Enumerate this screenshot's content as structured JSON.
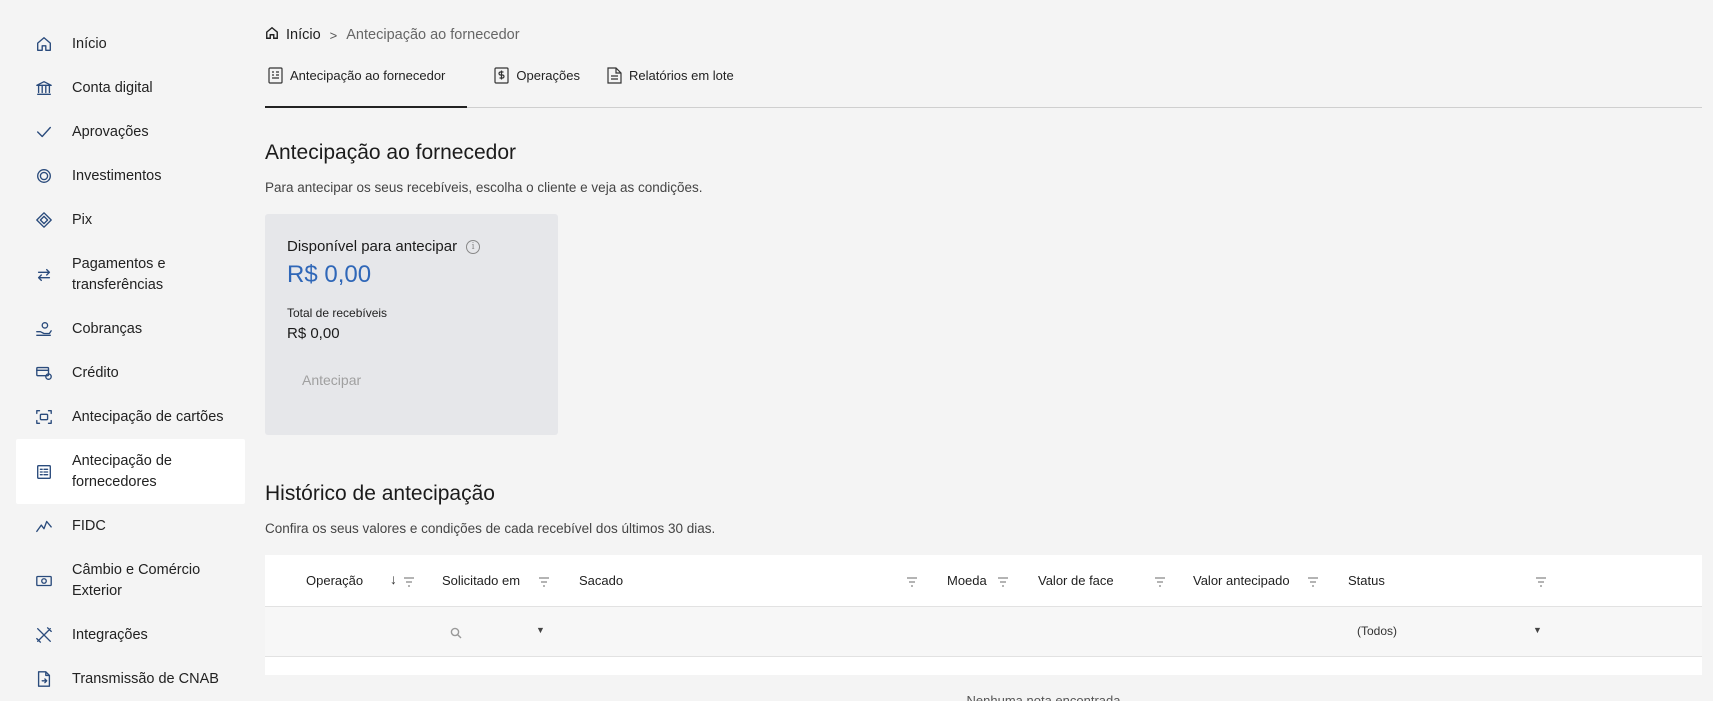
{
  "sidebar": {
    "items": [
      {
        "label": "Início",
        "icon": "home-icon"
      },
      {
        "label": "Conta digital",
        "icon": "bank-icon"
      },
      {
        "label": "Aprovações",
        "icon": "check-icon"
      },
      {
        "label": "Investimentos",
        "icon": "investment-icon"
      },
      {
        "label": "Pix",
        "icon": "pix-icon"
      },
      {
        "label": "Pagamentos e transferências",
        "icon": "transfer-icon"
      },
      {
        "label": "Cobranças",
        "icon": "billing-icon"
      },
      {
        "label": "Crédito",
        "icon": "credit-icon"
      },
      {
        "label": "Antecipação de cartões",
        "icon": "card-anticipation-icon"
      },
      {
        "label": "Antecipação de fornecedores",
        "icon": "supplier-anticipation-icon",
        "active": true
      },
      {
        "label": "FIDC",
        "icon": "chart-line-icon"
      },
      {
        "label": "Câmbio e Comércio Exterior",
        "icon": "exchange-icon"
      },
      {
        "label": "Integrações",
        "icon": "tools-icon"
      },
      {
        "label": "Transmissão de CNAB",
        "icon": "file-transmit-icon"
      }
    ]
  },
  "breadcrumb": {
    "home": "Início",
    "separator": ">",
    "current": "Antecipação ao fornecedor"
  },
  "tabs": [
    {
      "label": "Antecipação ao fornecedor",
      "active": true
    },
    {
      "label": "Operações"
    },
    {
      "label": "Relatórios em lote"
    }
  ],
  "header": {
    "title": "Antecipação ao fornecedor",
    "subtitle": "Para antecipar os seus recebíveis, escolha o cliente e veja as condições."
  },
  "card": {
    "label": "Disponível para antecipar",
    "info_symbol": "i",
    "amount": "R$ 0,00",
    "total_label": "Total de recebíveis",
    "total_value": "R$ 0,00",
    "button": "Antecipar"
  },
  "history": {
    "title": "Histórico de antecipação",
    "subtitle": "Confira os seus valores e condições de cada recebível dos últimos 30 dias.",
    "columns": [
      "Operação",
      "Solicitado em",
      "Sacado",
      "Moeda",
      "Valor de face",
      "Valor antecipado",
      "Status"
    ],
    "sort_symbol": "↓",
    "dropdown_caret": "▼",
    "status_filter": "(Todos)",
    "empty_message": "Nenhuma nota encontrada"
  },
  "colors": {
    "accent": "#2f67b8",
    "icon": "#2a4b7c",
    "background": "#f4f4f4",
    "card": "#e6e7ea"
  }
}
